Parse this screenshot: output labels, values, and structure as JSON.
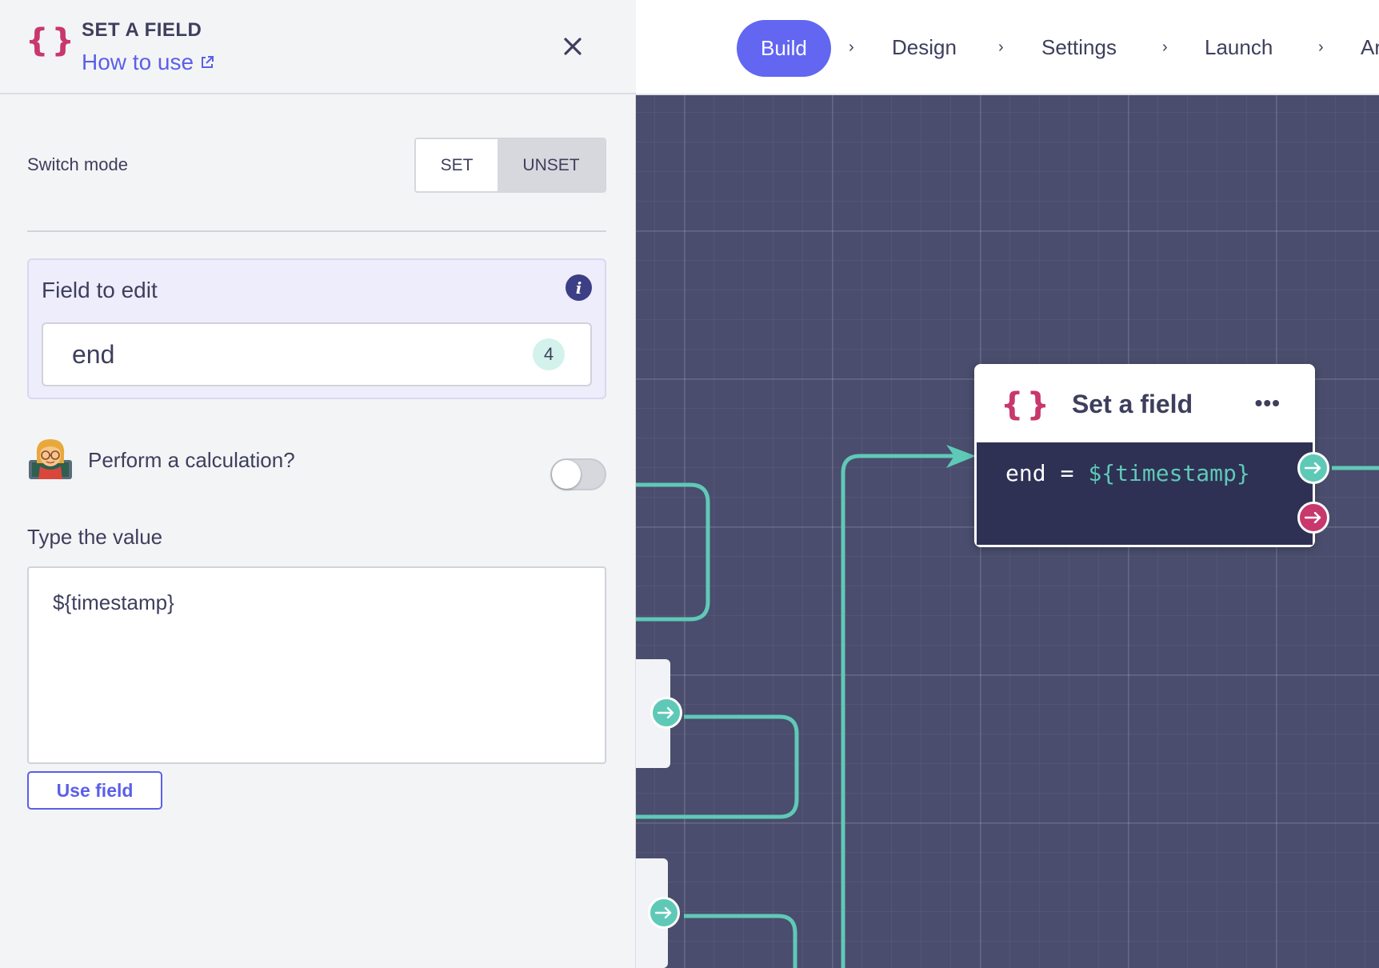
{
  "panel": {
    "icon": "braces-icon",
    "title": "SET A FIELD",
    "howto_label": "How to use",
    "mode_label": "Switch mode",
    "mode_options": [
      "SET",
      "UNSET"
    ],
    "mode_selected": "SET",
    "field_label": "Field to edit",
    "field_value": "end",
    "field_count": "4",
    "calc_label": "Perform a calculation?",
    "calc_enabled": false,
    "value_label": "Type the value",
    "value_text": "${timestamp}",
    "use_field_label": "Use field"
  },
  "nav": {
    "steps": [
      "Build",
      "Design",
      "Settings",
      "Launch",
      "Ar"
    ],
    "active": "Build",
    "chevron": "›"
  },
  "node": {
    "icon": "braces-icon",
    "title": "Set a field",
    "menu": "•••",
    "variable": "end",
    "operator": "=",
    "value": "${timestamp}"
  },
  "colors": {
    "accent": "#6266f1",
    "brand_red": "#c8386c",
    "teal": "#5fc9b7",
    "canvas": "#4a4d6d",
    "node_body": "#2e3154"
  }
}
